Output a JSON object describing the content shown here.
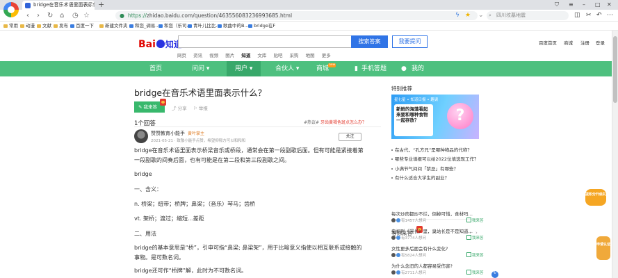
{
  "browser": {
    "tab_title": "bridge在音乐术语里面表示什么_百度知道",
    "tab_close": "×",
    "new_tab": "+",
    "url_protocol": "https://",
    "url_rest": "zhidao.baidu.com/question/463556083236993685.html",
    "search_placeholder": "四川坟墓地震",
    "nav": {
      "back": "‹",
      "forward": "›",
      "reload": "↻",
      "home": "⌂",
      "star": "☆"
    },
    "win": {
      "minimize": "–",
      "maximize": "□",
      "close": "✕"
    },
    "bookmarks": [
      "常用",
      "动漫",
      "文献",
      "发布",
      "百度一下",
      "新建文件夹",
      "和您_调易...",
      "和您（乐司...",
      "青叶儿比比...",
      "歌曲中的B...",
      "bridge在F"
    ]
  },
  "header": {
    "logo_text": "Bai",
    "logo_zd": "知道",
    "search_button": "搜索答案",
    "ask_button": "我要提问",
    "top_links": [
      "百度首页",
      "商城",
      "注册",
      "登录"
    ],
    "subnav": [
      "网页",
      "资讯",
      "视频",
      "图片",
      "知道",
      "文库",
      "贴吧",
      "采购",
      "地图",
      "更多"
    ],
    "subnav_active": "知道"
  },
  "greennav": {
    "items": [
      "首页",
      "问问 ▾",
      "用户 ▾",
      "合伙人 ▾",
      "商城",
      "手机答题",
      "我的"
    ],
    "hot_badge": "new"
  },
  "question": {
    "title": "bridge在音乐术语里面表示什么？",
    "answer_button": "我来答",
    "share": "分享",
    "report": "举报",
    "answer_count": "1个回答",
    "tag_text": "#热议#",
    "tag_link": "牙齿黄褐色斑点怎么办？"
  },
  "answer": {
    "author": "赞赞教育小能手",
    "level": "黄叶掌主",
    "meta": "2021-05-21 · 致敬小能手点赞，希望抑郁方可以和和和",
    "follow": "关注",
    "paragraphs": [
      "bridge在音乐术语里面表示桥梁音乐或桥段，通常会在第一段副歌后面。但有可能是紧接着第一段副歌的间奏后面，也有可能是在第二段和第三段副歌之间。",
      "bridge",
      "一、含义：",
      "n. 桥梁；纽带；桥牌；鼻梁；（音乐）琴马；齿桥",
      "vt. 架桥；渡过；缩短...差距",
      "二、用法",
      "bridge的基本意思是“桥”，引申可指“鼻梁; 鼻梁架”，用于比喻意义指使以相互联系或接触的事物。是可数名词。",
      "bridge还可作“桥牌”解，此时为不可数名词。"
    ]
  },
  "sidebar": {
    "title": "特别推荐",
    "banner_head": "星七星 ∙ 知道日报 ∙ 趣读",
    "banner_card": "新鲜的海藻看起来要和哪种食物一起存放？",
    "banner_q": "?",
    "list": [
      "在古代，“孔方兄”是哪种物品的代称？",
      "哪些专业填报可以给2022位填选现工作？",
      "小满节气间间「禁忌」有哪些？",
      "有什么适合大学生的副业？"
    ],
    "hot_title": "等你来答",
    "hot_prev": "‹",
    "hot_next": "›",
    "hot": [
      {
        "q": "每次炒肉都炒不烂，倒掉可惜，食材吗…",
        "meta": "有1457人想问",
        "action": "我来答"
      },
      {
        "q": "电视剧《漫长》里，臭站长是不是知道…",
        "meta": "有3774人想问",
        "action": "我来答"
      },
      {
        "q": "女性更多后面会有什么变化?",
        "meta": "有5824人想问",
        "action": "我来答"
      },
      {
        "q": "为什么念旧的人都容易受伤害?",
        "meta": "有2711人想问",
        "action": "我来答"
      }
    ],
    "float_top": "提积分升级礼",
    "float_bottom": "申请认证"
  }
}
